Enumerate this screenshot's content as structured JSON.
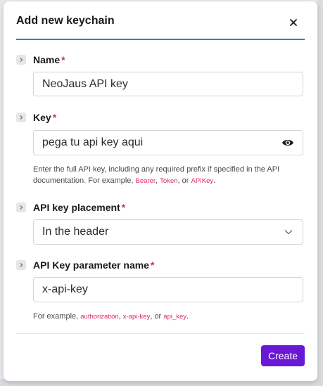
{
  "dialog": {
    "title": "Add new keychain"
  },
  "fields": {
    "name": {
      "label": "Name",
      "required_mark": "*",
      "value": "NeoJaus API key"
    },
    "key": {
      "label": "Key",
      "required_mark": "*",
      "value": "pega tu api key aqui",
      "help_text_1": "Enter the full API key, including any required prefix if specified in the API documentation. For example, ",
      "example_1": "Bearer",
      "sep_1": ", ",
      "example_2": "Token",
      "sep_2": ", or ",
      "example_3": "APIKey",
      "end": "."
    },
    "placement": {
      "label": "API key placement",
      "required_mark": "*",
      "selected": "In the header"
    },
    "param_name": {
      "label": "API Key parameter name",
      "required_mark": "*",
      "value": "x-api-key",
      "help_prefix": "For example, ",
      "example_1": "authorization",
      "sep_1": ", ",
      "example_2": "x-api-key",
      "sep_2": ", or ",
      "example_3": "api_key",
      "end": "."
    }
  },
  "footer": {
    "create_label": "Create"
  },
  "colors": {
    "accent": "#6a18d6",
    "required": "#e0284f",
    "header_rule": "#2b7de0",
    "code_text": "#e0286f"
  },
  "icons": {
    "close": "close-icon",
    "chevron": "chevron-right-icon",
    "eye": "eye-icon",
    "dropdown": "chevron-down-icon"
  }
}
